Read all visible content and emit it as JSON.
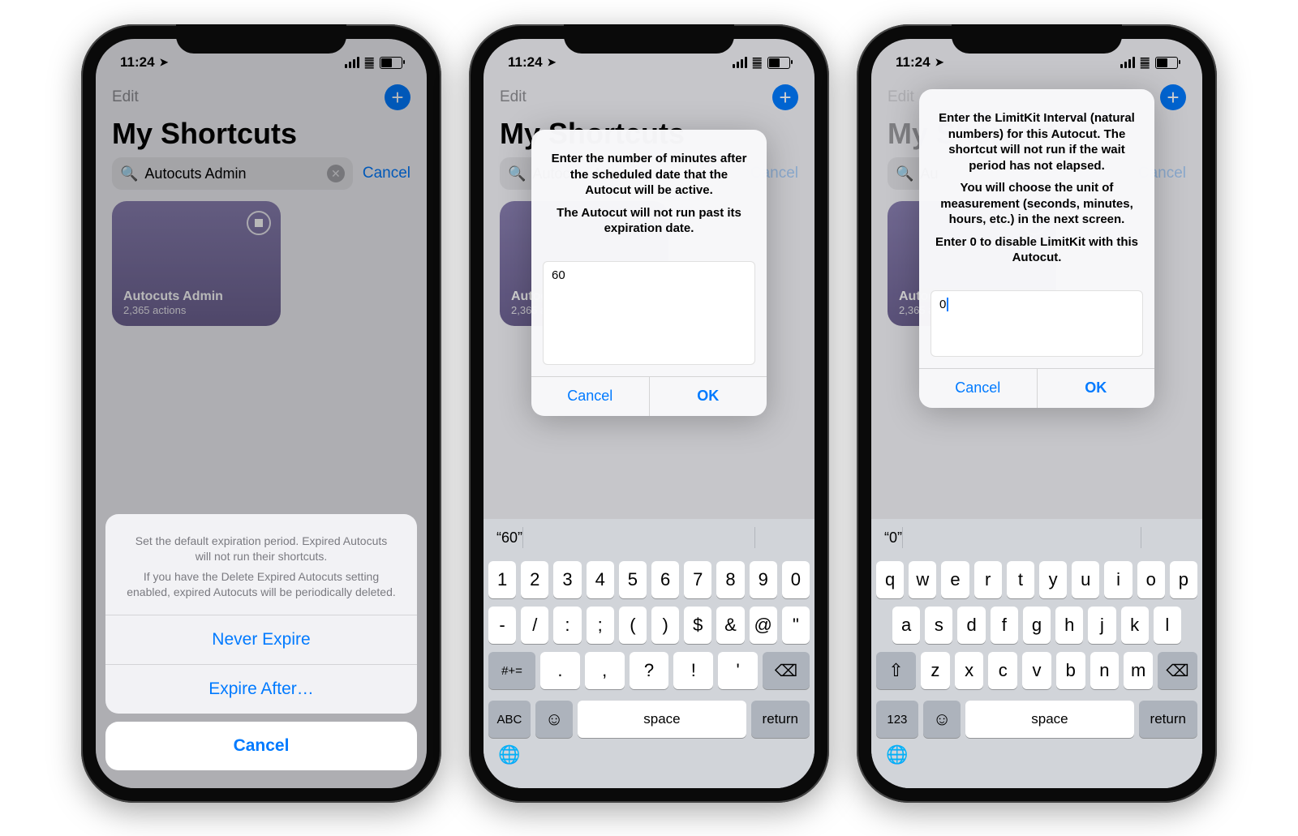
{
  "statusbar": {
    "time": "11:24",
    "location_glyph": "➤"
  },
  "nav": {
    "edit": "Edit",
    "add_icon": "+"
  },
  "page_title": "My Shortcuts",
  "search": {
    "query": "Autocuts Admin",
    "cancel": "Cancel",
    "search_glyph": "🔍",
    "clear_glyph": "✕"
  },
  "card": {
    "name": "Autocuts Admin",
    "subtitle": "2,365 actions"
  },
  "phone1": {
    "sheet_message_line1": "Set the default expiration period. Expired Autocuts will not run their shortcuts.",
    "sheet_message_line2": "If you have the Delete Expired Autocuts setting enabled, expired Autocuts will be periodically deleted.",
    "option_never": "Never Expire",
    "option_after": "Expire After…",
    "cancel": "Cancel"
  },
  "phone2": {
    "alert_line1": "Enter the number of minutes after the scheduled date that the Autocut will be active.",
    "alert_line2": "The Autocut will not run past its expiration date.",
    "input_value": "60",
    "cancel": "Cancel",
    "ok": "OK",
    "suggestion": "“60”",
    "keyboard": {
      "row1": [
        "1",
        "2",
        "3",
        "4",
        "5",
        "6",
        "7",
        "8",
        "9",
        "0"
      ],
      "row2": [
        "-",
        "/",
        ":",
        ";",
        "(",
        ")",
        "$",
        "&",
        "@",
        "\""
      ],
      "row3_toggle": "#+=",
      "row3": [
        ".",
        ",",
        "?",
        "!",
        "'"
      ],
      "delete_glyph": "⌫",
      "abc": "ABC",
      "emoji": "☺",
      "space": "space",
      "return": "return",
      "globe": "🌐"
    }
  },
  "phone3": {
    "alert_line1": "Enter the LimitKit Interval (natural numbers) for this Autocut. The shortcut will not run if the wait period has not elapsed.",
    "alert_line2": "You will choose the unit of measurement (seconds, minutes, hours, etc.) in the next screen.",
    "alert_line3": "Enter 0 to disable LimitKit with this Autocut.",
    "input_value": "0",
    "cancel": "Cancel",
    "ok": "OK",
    "suggestion": "“0”",
    "keyboard": {
      "row1": [
        "q",
        "w",
        "e",
        "r",
        "t",
        "y",
        "u",
        "i",
        "o",
        "p"
      ],
      "row2": [
        "a",
        "s",
        "d",
        "f",
        "g",
        "h",
        "j",
        "k",
        "l"
      ],
      "shift": "⇧",
      "row3": [
        "z",
        "x",
        "c",
        "v",
        "b",
        "n",
        "m"
      ],
      "delete_glyph": "⌫",
      "mode": "123",
      "emoji": "☺",
      "space": "space",
      "return": "return",
      "globe": "🌐"
    }
  }
}
